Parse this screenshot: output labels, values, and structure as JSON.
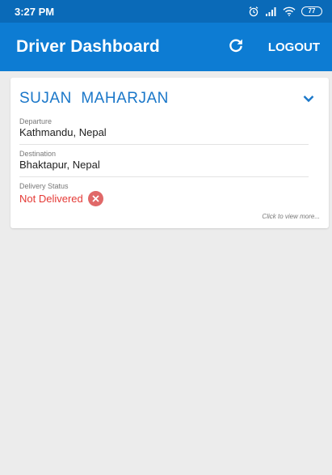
{
  "status_bar": {
    "time": "3:27 PM",
    "icons": [
      "alarm-icon",
      "signal-icon",
      "wifi-icon",
      "battery-icon"
    ],
    "battery": "77"
  },
  "app_bar": {
    "title": "Driver Dashboard",
    "refresh_icon": "refresh-icon",
    "logout_label": "LOGOUT",
    "color": "#0d7cd3"
  },
  "delivery_card": {
    "driver_name": "SUJAN  MAHARJAN",
    "expand_icon": "chevron-down-icon",
    "departure_label": "Departure",
    "departure_value": "Kathmandu, Nepal",
    "destination_label": "Destination",
    "destination_value": "Bhaktapur, Nepal",
    "status_label": "Delivery Status",
    "status_value": "Not Delivered",
    "status_icon": "close-circle-icon",
    "status_color": "#e53935",
    "view_more": "Click to view more..."
  }
}
